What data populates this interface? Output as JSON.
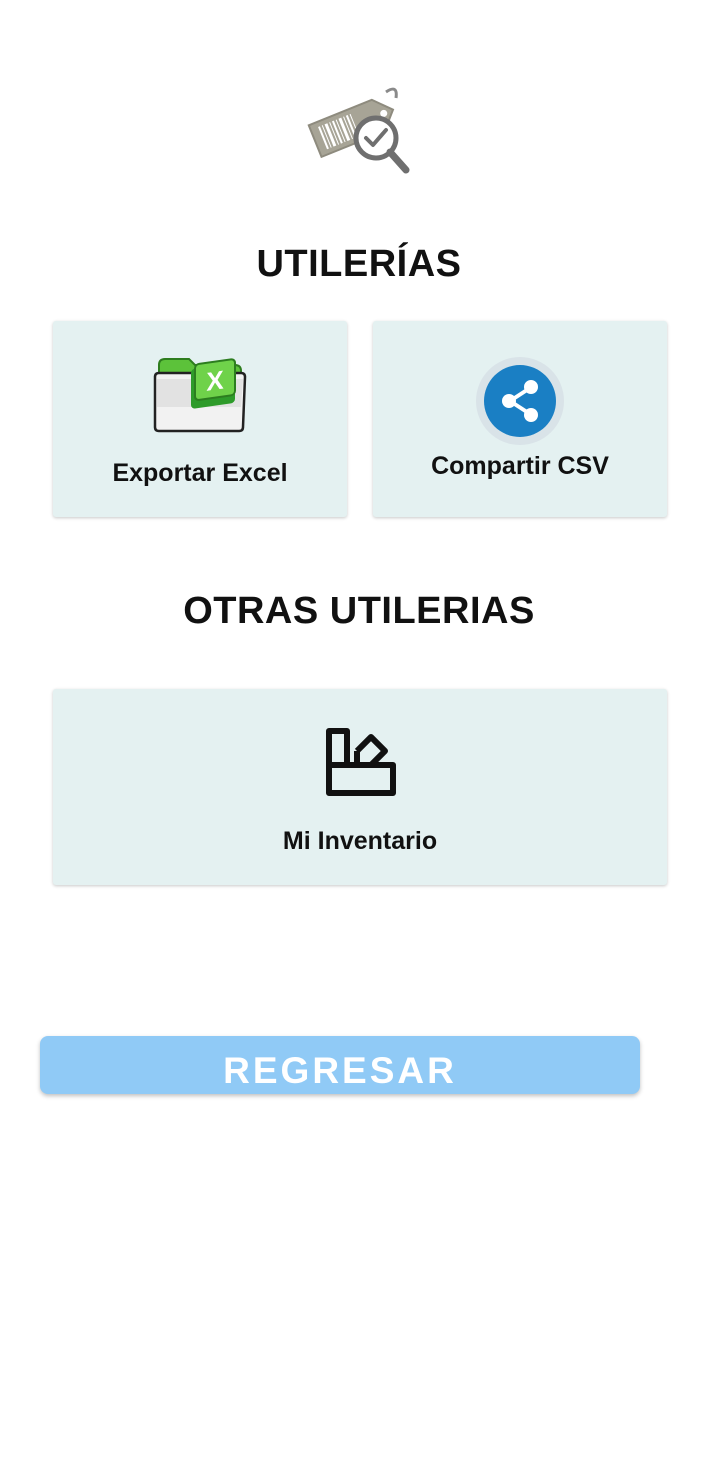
{
  "header": {
    "logo_icon": "price-tag-search-icon"
  },
  "sections": {
    "utilerias_title": "UTILERÍAS",
    "otras_title": "OTRAS UTILERIAS"
  },
  "cards": {
    "export_excel": {
      "label": "Exportar Excel",
      "icon": "excel-folder-icon"
    },
    "share_csv": {
      "label": "Compartir CSV",
      "icon": "share-icon"
    },
    "inventory": {
      "label": "Mi Inventario",
      "icon": "inventory-icon"
    }
  },
  "back_button": {
    "label": "REGRESAR"
  },
  "colors": {
    "card_background": "#e4f1f1",
    "button_background": "#90caf6",
    "share_blue": "#1a7fc4",
    "excel_green": "#5cc23a"
  }
}
